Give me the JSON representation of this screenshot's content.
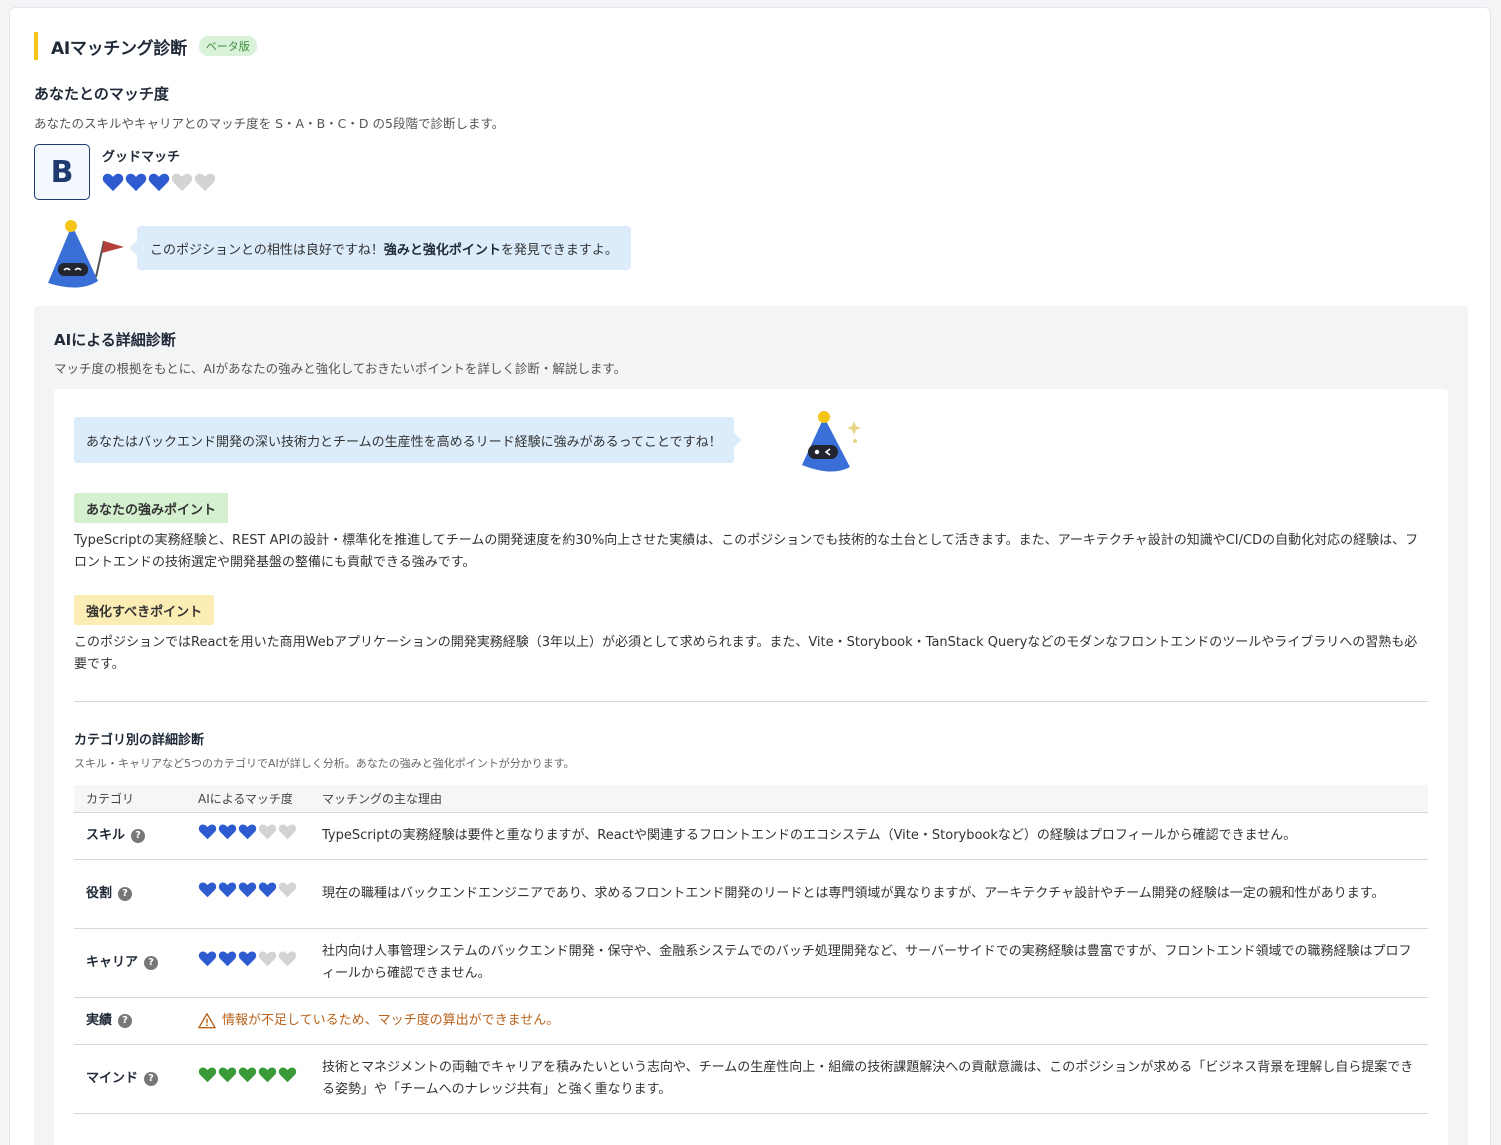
{
  "header": {
    "title": "AIマッチング診断",
    "badge": "ベータ版"
  },
  "match": {
    "title": "あなたとのマッチ度",
    "description": "あなたのスキルやキャリアとのマッチ度を S・A・B・C・D の5段階で診断します。",
    "grade": "B",
    "grade_label": "グッドマッチ",
    "hearts_filled": 3,
    "hearts_total": 5,
    "bubble_pre": "このポジションとの相性は良好ですね！",
    "bubble_bold": "強みと強化ポイント",
    "bubble_post": "を発見できますよ。"
  },
  "detail": {
    "title": "AIによる詳細診断",
    "description": "マッチ度の根拠をもとに、AIがあなたの強みと強化しておきたいポイントを詳しく診断・解説します。",
    "bubble": "あなたはバックエンド開発の深い技術力とチームの生産性を高めるリード経験に強みがあるってことですね！",
    "strength_label": "あなたの強みポイント",
    "strength_text": "TypeScriptの実務経験と、REST APIの設計・標準化を推進してチームの開発速度を約30%向上させた実績は、このポジションでも技術的な土台として活きます。また、アーキテクチャ設計の知識やCI/CDの自動化対応の経験は、フロントエンドの技術選定や開発基盤の整備にも貢献できる強みです。",
    "improve_label": "強化すべきポイント",
    "improve_text": "このポジションではReactを用いた商用Webアプリケーションの開発実務経験（3年以上）が必須として求められます。また、Vite・Storybook・TanStack Queryなどのモダンなフロントエンドのツールやライブラリへの習熟も必要です。",
    "category_title": "カテゴリ別の詳細診断",
    "category_desc": "スキル・キャリアなど5つのカテゴリでAIが詳しく分析。あなたの強みと強化ポイントが分かります。",
    "columns": [
      "カテゴリ",
      "AIによるマッチ度",
      "マッチングの主な理由"
    ],
    "rows": [
      {
        "name": "スキル",
        "hearts": 3,
        "color": "#2f5bd0",
        "reason": "TypeScriptの実務経験は要件と重なりますが、Reactや関連するフロントエンドのエコシステム（Vite・Storybookなど）の経験はプロフィールから確認できません。"
      },
      {
        "name": "役割",
        "hearts": 4,
        "color": "#2f5bd0",
        "reason": "現在の職種はバックエンドエンジニアであり、求めるフロントエンド開発のリードとは専門領域が異なりますが、アーキテクチャ設計やチーム開発の経験は一定の親和性があります。"
      },
      {
        "name": "キャリア",
        "hearts": 3,
        "color": "#2f5bd0",
        "reason": "社内向け人事管理システムのバックエンド開発・保守や、金融系システムでのバッチ処理開発など、サーバーサイドでの実務経験は豊富ですが、フロントエンド領域での職務経験はプロフィールから確認できません。"
      },
      {
        "name": "実績",
        "warning": "情報が不足しているため、マッチ度の算出ができません。"
      },
      {
        "name": "マインド",
        "hearts": 5,
        "color": "#3a9a3a",
        "reason": "技術とマネジメントの両軸でキャリアを積みたいという志向や、チームの生産性向上・組織の技術課題解決への貢献意識は、このポジションが求める「ビジネス背景を理解し自ら提案できる姿勢」や「チームへのナレッジ共有」と強く重なります。"
      }
    ]
  },
  "colors": {
    "accent_yellow": "#f5c518",
    "heart_blue": "#2f5bd0",
    "heart_green": "#3a9a3a",
    "heart_empty": "#d3d3d3",
    "warning": "#b8641e"
  }
}
